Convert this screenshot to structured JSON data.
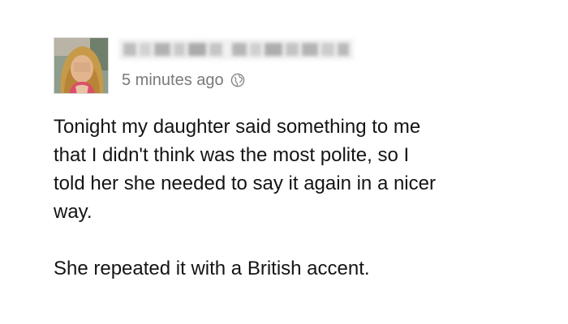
{
  "post": {
    "timestamp": "5 minutes ago",
    "privacy_icon": "globe-icon",
    "message_lines": [
      "Tonight my daughter said something to me",
      "that I didn't think was the most polite, so I",
      "told her she needed to say it again in a nicer",
      "way."
    ],
    "message_second_paragraph": "She repeated it with a British accent."
  },
  "colors": {
    "meta_text": "#7a7a7a",
    "body_text": "#141414",
    "background": "#ffffff"
  }
}
